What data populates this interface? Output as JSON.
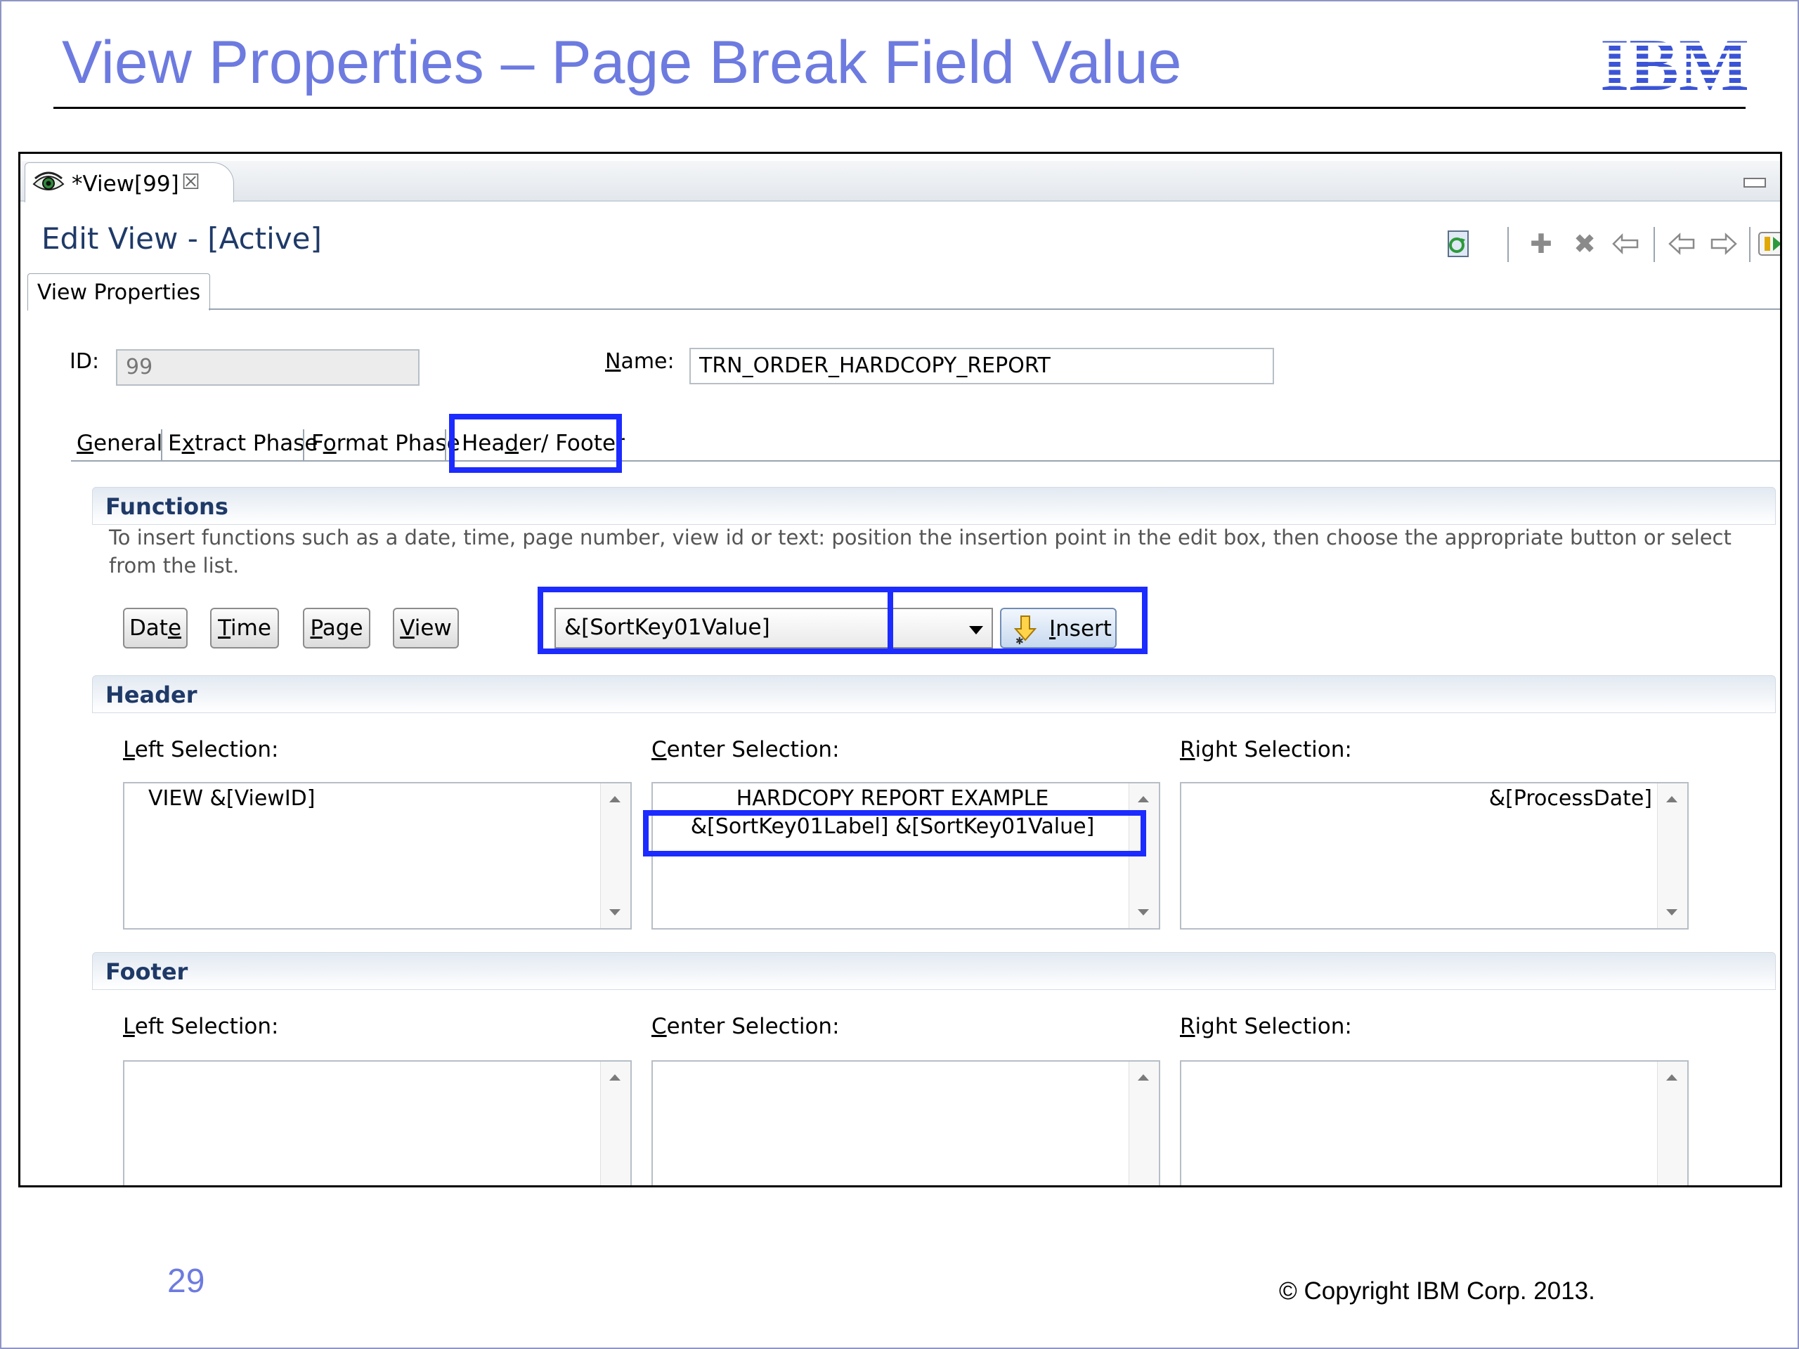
{
  "slide": {
    "title": "View Properties – Page Break Field Value",
    "page_number": "29",
    "copyright": "© Copyright IBM Corp. 2013.",
    "logo": "IBM"
  },
  "editor_tab": {
    "title": "*View[99]",
    "icon": "eye-icon"
  },
  "edit_view": {
    "title": "Edit View - [Active]"
  },
  "toolbar": {
    "items": [
      "refresh-icon",
      "add-icon",
      "delete-icon",
      "undo-icon",
      "back-icon",
      "forward-icon",
      "run-icon"
    ]
  },
  "view_properties_tab": "View Properties",
  "fields": {
    "id_label": "ID:",
    "id_value": "99",
    "name_label": "Name:",
    "name_value": "TRN_ORDER_HARDCOPY_REPORT"
  },
  "subtabs": [
    "General",
    "Extract Phase",
    "Format Phase",
    "Header/ Footer"
  ],
  "functions": {
    "title": "Functions",
    "description": "To insert functions such as a date, time, page number, view id or text: position the insertion point in the edit box, then choose the appropriate button or select from the list.",
    "buttons": [
      "Date",
      "Time",
      "Page",
      "View"
    ],
    "combo_value": "&[SortKey01Value]",
    "insert_label": "Insert"
  },
  "header": {
    "title": "Header",
    "left_label": "Left Selection:",
    "center_label": "Center Selection:",
    "right_label": "Right Selection:",
    "left_text": "VIEW &[ViewID]",
    "center_line1": "HARDCOPY REPORT EXAMPLE",
    "center_line2": "&[SortKey01Label]  &[SortKey01Value]",
    "right_text": "&[ProcessDate]"
  },
  "footer": {
    "title": "Footer",
    "left_label": "Left Selection:",
    "center_label": "Center Selection:",
    "right_label": "Right Selection:"
  },
  "colors": {
    "title": "#6d7be0",
    "highlight": "#1c2bff",
    "section_title": "#1f3a68"
  }
}
